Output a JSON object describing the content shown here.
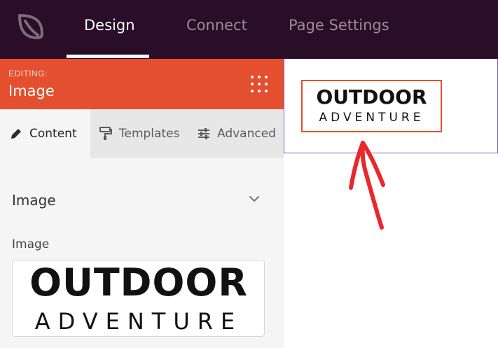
{
  "nav": {
    "tabs": [
      {
        "label": "Design"
      },
      {
        "label": "Connect"
      },
      {
        "label": "Page Settings"
      }
    ]
  },
  "editor": {
    "editing_label": "EDITING:",
    "title": "Image",
    "subtabs": [
      {
        "label": "Content",
        "icon": "pencil-icon"
      },
      {
        "label": "Templates",
        "icon": "paint-roller-icon"
      },
      {
        "label": "Advanced",
        "icon": "sliders-icon"
      }
    ],
    "section_title": "Image",
    "field_label": "Image"
  },
  "image": {
    "line1": "OUTDOOR",
    "line2": "ADVENTURE"
  },
  "colors": {
    "topbar": "#2a0d27",
    "accent": "#e4502f",
    "selection": "#7c5bc0",
    "arrow": "#e8282b"
  }
}
